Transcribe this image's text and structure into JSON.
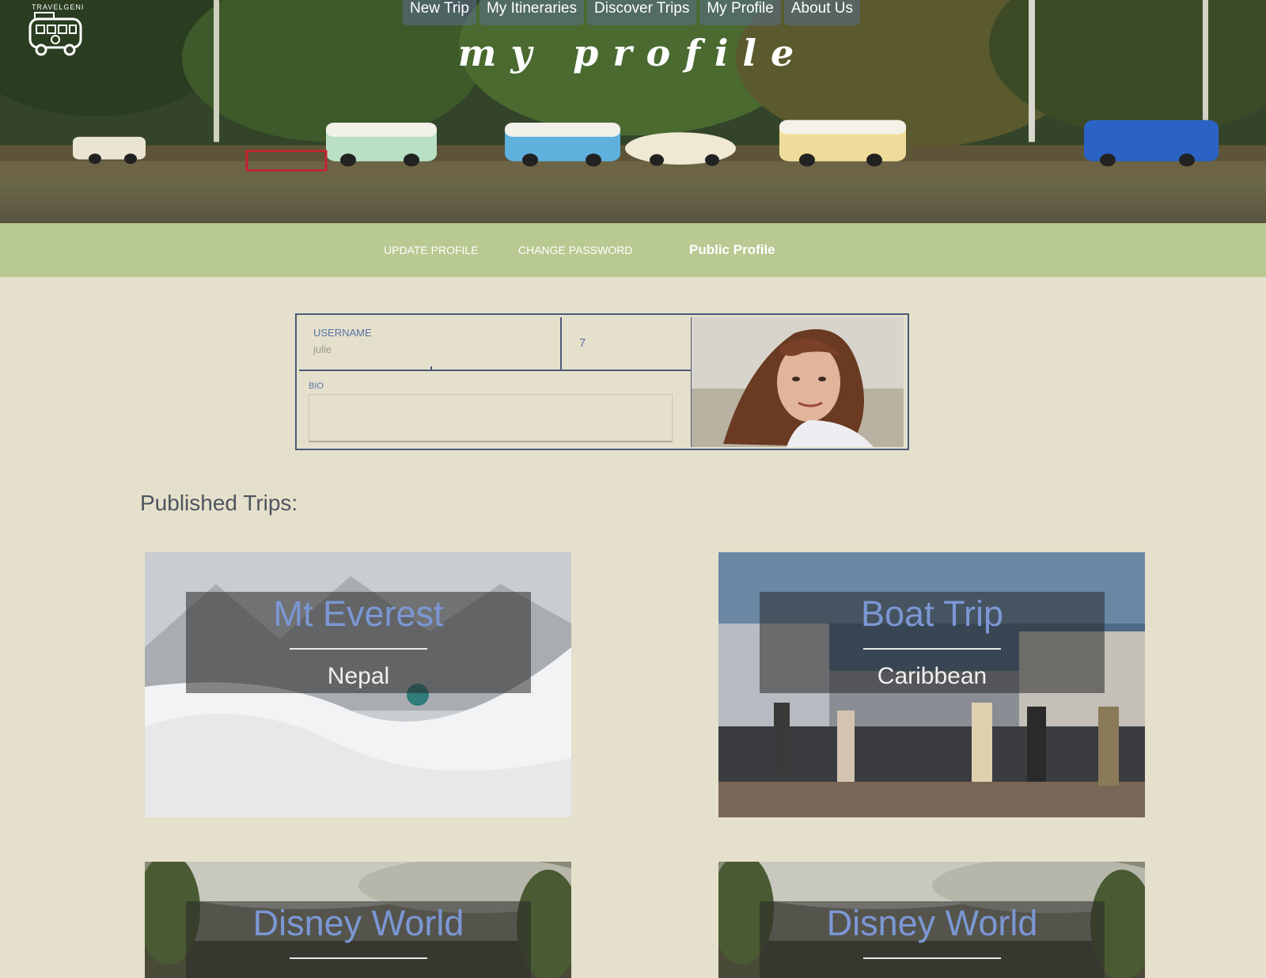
{
  "brand": {
    "logo_text": "TRAVELGENI"
  },
  "nav": {
    "items": [
      {
        "label": "New Trip"
      },
      {
        "label": "My Itineraries"
      },
      {
        "label": "Discover Trips"
      },
      {
        "label": "My Profile"
      },
      {
        "label": "About Us"
      }
    ]
  },
  "hero": {
    "title": "my profile"
  },
  "tabs": {
    "update": "UPDATE PROFILE",
    "password": "CHANGE PASSWORD",
    "public": "Public Profile"
  },
  "profile": {
    "username_label": "USERNAME",
    "username_value": "julie",
    "number_value": "7",
    "bio_label": "BIO",
    "bio_value": ""
  },
  "published": {
    "title": "Published Trips:",
    "trips": [
      {
        "title": "Mt Everest",
        "subtitle": "Nepal"
      },
      {
        "title": "Boat Trip",
        "subtitle": "Caribbean"
      },
      {
        "title": "Disney World",
        "subtitle": ""
      },
      {
        "title": "Disney World",
        "subtitle": ""
      }
    ]
  }
}
